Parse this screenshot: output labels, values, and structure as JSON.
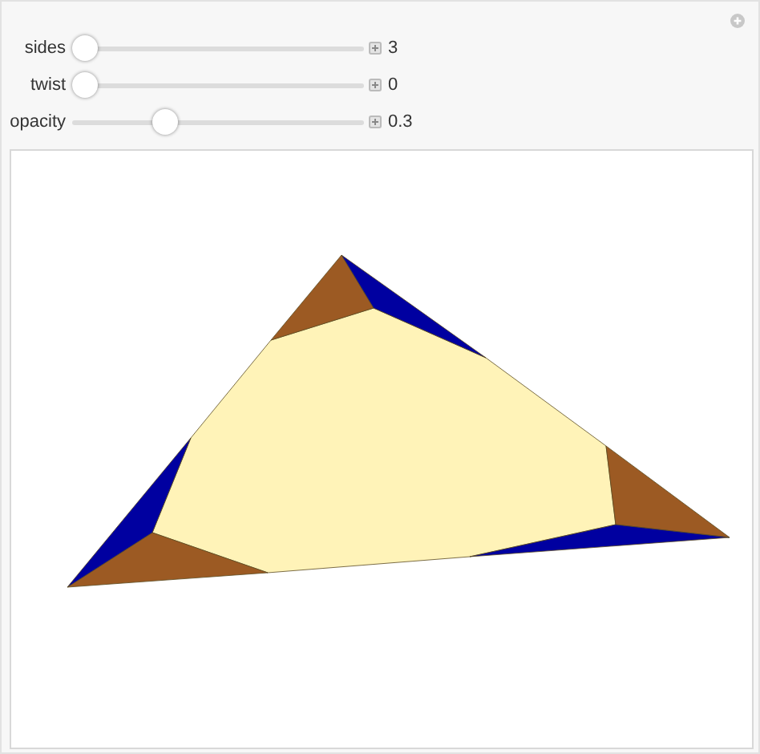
{
  "controls": [
    {
      "label": "sides",
      "level": 0,
      "value": "3"
    },
    {
      "label": "twist",
      "level": 0,
      "value": "0"
    },
    {
      "label": "opacity",
      "level": 0.3,
      "value": "0.3"
    }
  ]
}
